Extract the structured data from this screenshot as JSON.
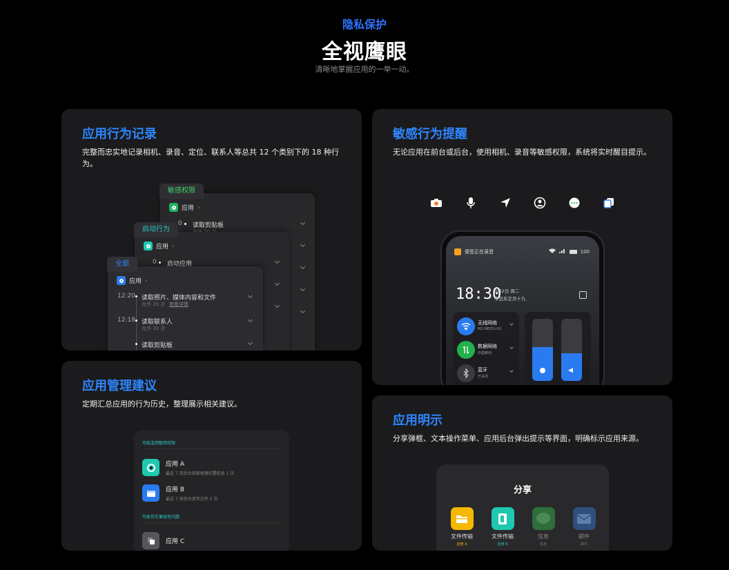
{
  "header": {
    "tag": "隐私保护",
    "title": "全视鹰眼",
    "subtitle": "清晰地掌握应用的一举一动。"
  },
  "behavior_log": {
    "title": "应用行为记录",
    "desc": "完整而忠实地记录相机、录音、定位、联系人等总共 12 个类别下的 18 种行为。",
    "panel_back": {
      "tab": "敏感权限",
      "app": "应用",
      "row_time": "0",
      "row_text": "读取剪贴板",
      "row_sub": "允许 20 次"
    },
    "panel_mid": {
      "tab": "启动行为",
      "app": "应用",
      "row_time": "0",
      "row_text": "启动应用"
    },
    "panel_front": {
      "tab": "全部",
      "app": "应用",
      "rows": [
        {
          "time": "12:20",
          "text": "读取照片、媒体内容和文件",
          "sub": "允许 20 次",
          "link": "查看详情"
        },
        {
          "time": "12:18",
          "text": "读取联系人",
          "sub": "允许 32 次"
        },
        {
          "time": "",
          "text": "读取剪贴板",
          "sub": ""
        }
      ]
    }
  },
  "sensitive": {
    "title": "敏感行为提醒",
    "desc": "无论应用在前台或后台，使用相机、录音等敏感权限，系统将实时醒目提示。",
    "icons": [
      {
        "name": "camera-icon",
        "color": "#f08030"
      },
      {
        "name": "microphone-icon",
        "color": "#f2a21f"
      },
      {
        "name": "location-icon",
        "color": "#2a7bf0"
      },
      {
        "name": "contacts-icon",
        "color": "#22b04a"
      },
      {
        "name": "message-icon",
        "color": "#2bbf46"
      },
      {
        "name": "copy-icon",
        "color": "#2a7bf0"
      }
    ],
    "phone": {
      "status_notice": "便签正在录音",
      "battery": "100",
      "time": "18:30",
      "date": "3月2日 周二",
      "lunar": "辛丑年正月十九",
      "wifi_label": "无线网络",
      "wifi_sub": "MZ-MEIZU-5G",
      "data_label": "数据网络",
      "data_sub": "中国移动",
      "bt_label": "蓝牙",
      "bt_sub": "已关闭",
      "brightness_level": 0.55,
      "volume_level": 0.45
    }
  },
  "manage": {
    "title": "应用管理建议",
    "desc": "定期汇总应用的行为历史，整理展示相关建议。",
    "section1": "可能滥用敏感权限",
    "section2": "可能存在兼容性问题",
    "items": [
      {
        "name": "应用 A",
        "desc": "最近 7 天后台获取地理位置信息 1 次"
      },
      {
        "name": "应用 B",
        "desc": "最近 7 天后台读写文件 2 次"
      },
      {
        "name": "应用 C",
        "desc": ""
      }
    ]
  },
  "display": {
    "title": "应用明示",
    "desc": "分享弹框、文本操作菜单、应用后台弹出提示等界面，明确标示应用来源。",
    "share_title": "分享",
    "targets": [
      {
        "label": "文件传输",
        "caption": "应用 A",
        "color": "#f5b800",
        "cap_color": "#f5b800"
      },
      {
        "label": "文件传输",
        "caption": "应用 B",
        "color": "#1fc8b0",
        "cap_color": "#1fc8b0"
      },
      {
        "label": "信息",
        "caption": "信息",
        "color": "#2d6e3a",
        "cap_color": "#777777"
      },
      {
        "label": "邮件",
        "caption": "邮件",
        "color": "#2f4f7d",
        "cap_color": "#777777"
      }
    ]
  }
}
